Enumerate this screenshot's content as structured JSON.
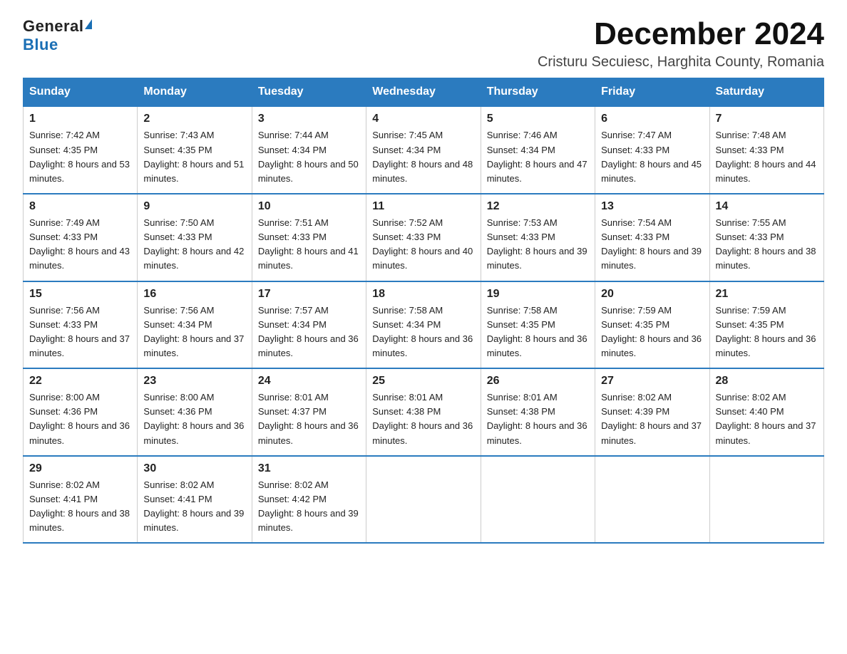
{
  "logo": {
    "general": "General",
    "blue": "Blue"
  },
  "title": "December 2024",
  "subtitle": "Cristuru Secuiesc, Harghita County, Romania",
  "weekdays": [
    "Sunday",
    "Monday",
    "Tuesday",
    "Wednesday",
    "Thursday",
    "Friday",
    "Saturday"
  ],
  "weeks": [
    [
      {
        "day": "1",
        "sunrise": "7:42 AM",
        "sunset": "4:35 PM",
        "daylight": "8 hours and 53 minutes."
      },
      {
        "day": "2",
        "sunrise": "7:43 AM",
        "sunset": "4:35 PM",
        "daylight": "8 hours and 51 minutes."
      },
      {
        "day": "3",
        "sunrise": "7:44 AM",
        "sunset": "4:34 PM",
        "daylight": "8 hours and 50 minutes."
      },
      {
        "day": "4",
        "sunrise": "7:45 AM",
        "sunset": "4:34 PM",
        "daylight": "8 hours and 48 minutes."
      },
      {
        "day": "5",
        "sunrise": "7:46 AM",
        "sunset": "4:34 PM",
        "daylight": "8 hours and 47 minutes."
      },
      {
        "day": "6",
        "sunrise": "7:47 AM",
        "sunset": "4:33 PM",
        "daylight": "8 hours and 45 minutes."
      },
      {
        "day": "7",
        "sunrise": "7:48 AM",
        "sunset": "4:33 PM",
        "daylight": "8 hours and 44 minutes."
      }
    ],
    [
      {
        "day": "8",
        "sunrise": "7:49 AM",
        "sunset": "4:33 PM",
        "daylight": "8 hours and 43 minutes."
      },
      {
        "day": "9",
        "sunrise": "7:50 AM",
        "sunset": "4:33 PM",
        "daylight": "8 hours and 42 minutes."
      },
      {
        "day": "10",
        "sunrise": "7:51 AM",
        "sunset": "4:33 PM",
        "daylight": "8 hours and 41 minutes."
      },
      {
        "day": "11",
        "sunrise": "7:52 AM",
        "sunset": "4:33 PM",
        "daylight": "8 hours and 40 minutes."
      },
      {
        "day": "12",
        "sunrise": "7:53 AM",
        "sunset": "4:33 PM",
        "daylight": "8 hours and 39 minutes."
      },
      {
        "day": "13",
        "sunrise": "7:54 AM",
        "sunset": "4:33 PM",
        "daylight": "8 hours and 39 minutes."
      },
      {
        "day": "14",
        "sunrise": "7:55 AM",
        "sunset": "4:33 PM",
        "daylight": "8 hours and 38 minutes."
      }
    ],
    [
      {
        "day": "15",
        "sunrise": "7:56 AM",
        "sunset": "4:33 PM",
        "daylight": "8 hours and 37 minutes."
      },
      {
        "day": "16",
        "sunrise": "7:56 AM",
        "sunset": "4:34 PM",
        "daylight": "8 hours and 37 minutes."
      },
      {
        "day": "17",
        "sunrise": "7:57 AM",
        "sunset": "4:34 PM",
        "daylight": "8 hours and 36 minutes."
      },
      {
        "day": "18",
        "sunrise": "7:58 AM",
        "sunset": "4:34 PM",
        "daylight": "8 hours and 36 minutes."
      },
      {
        "day": "19",
        "sunrise": "7:58 AM",
        "sunset": "4:35 PM",
        "daylight": "8 hours and 36 minutes."
      },
      {
        "day": "20",
        "sunrise": "7:59 AM",
        "sunset": "4:35 PM",
        "daylight": "8 hours and 36 minutes."
      },
      {
        "day": "21",
        "sunrise": "7:59 AM",
        "sunset": "4:35 PM",
        "daylight": "8 hours and 36 minutes."
      }
    ],
    [
      {
        "day": "22",
        "sunrise": "8:00 AM",
        "sunset": "4:36 PM",
        "daylight": "8 hours and 36 minutes."
      },
      {
        "day": "23",
        "sunrise": "8:00 AM",
        "sunset": "4:36 PM",
        "daylight": "8 hours and 36 minutes."
      },
      {
        "day": "24",
        "sunrise": "8:01 AM",
        "sunset": "4:37 PM",
        "daylight": "8 hours and 36 minutes."
      },
      {
        "day": "25",
        "sunrise": "8:01 AM",
        "sunset": "4:38 PM",
        "daylight": "8 hours and 36 minutes."
      },
      {
        "day": "26",
        "sunrise": "8:01 AM",
        "sunset": "4:38 PM",
        "daylight": "8 hours and 36 minutes."
      },
      {
        "day": "27",
        "sunrise": "8:02 AM",
        "sunset": "4:39 PM",
        "daylight": "8 hours and 37 minutes."
      },
      {
        "day": "28",
        "sunrise": "8:02 AM",
        "sunset": "4:40 PM",
        "daylight": "8 hours and 37 minutes."
      }
    ],
    [
      {
        "day": "29",
        "sunrise": "8:02 AM",
        "sunset": "4:41 PM",
        "daylight": "8 hours and 38 minutes."
      },
      {
        "day": "30",
        "sunrise": "8:02 AM",
        "sunset": "4:41 PM",
        "daylight": "8 hours and 39 minutes."
      },
      {
        "day": "31",
        "sunrise": "8:02 AM",
        "sunset": "4:42 PM",
        "daylight": "8 hours and 39 minutes."
      },
      null,
      null,
      null,
      null
    ]
  ]
}
